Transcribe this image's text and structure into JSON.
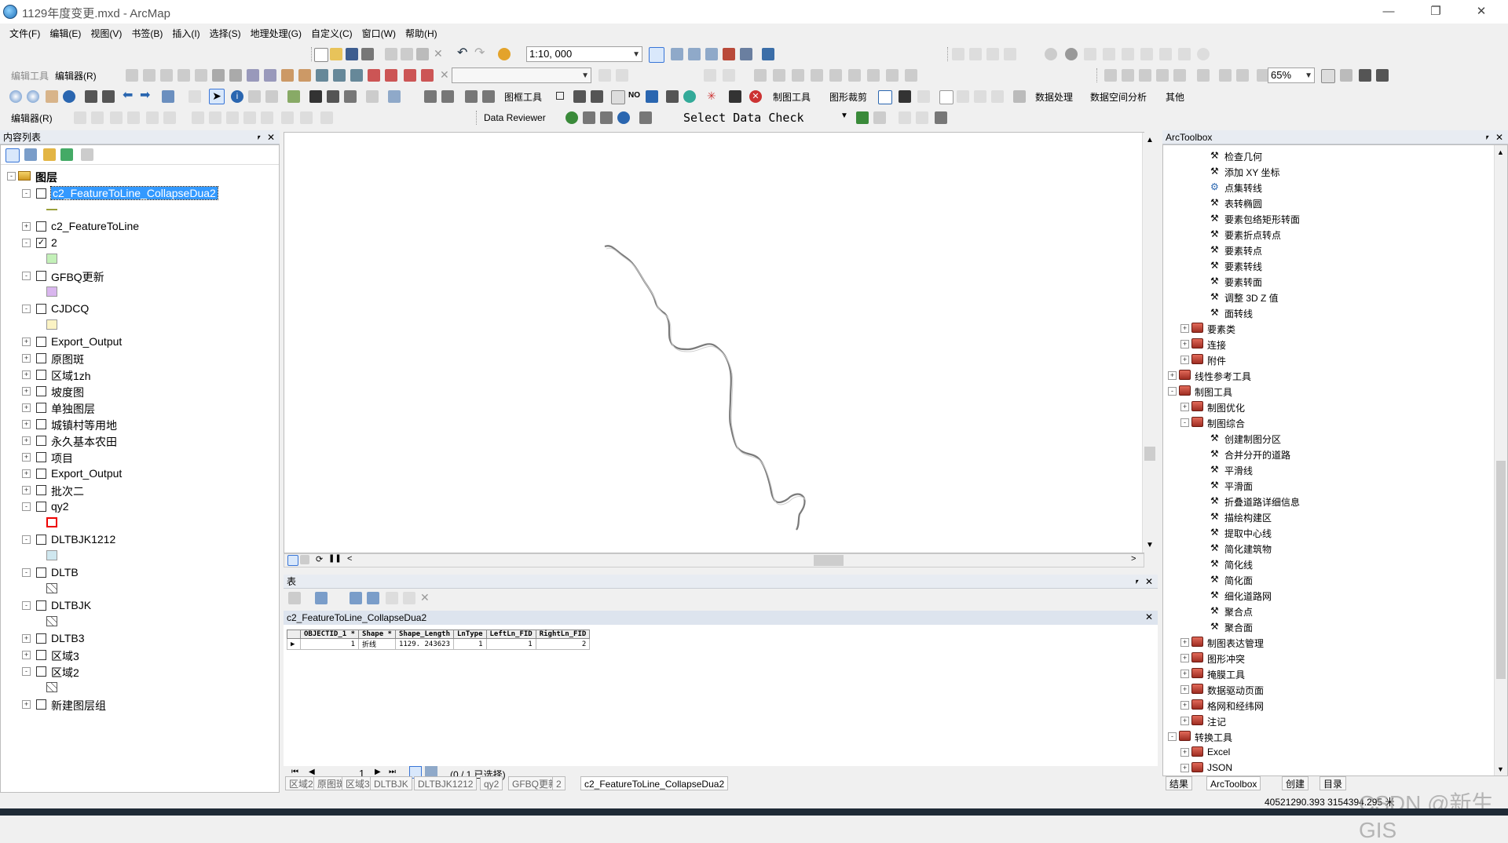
{
  "window": {
    "title": "1129年度变更.mxd - ArcMap"
  },
  "menu": [
    "文件(F)",
    "编辑(E)",
    "视图(V)",
    "书签(B)",
    "插入(I)",
    "选择(S)",
    "地理处理(G)",
    "自定义(C)",
    "窗口(W)",
    "帮助(H)"
  ],
  "toolbar": {
    "scale": "1:10, 000",
    "editor_tools_label": "编辑工具",
    "editor_menu": "编辑器(R)",
    "layout_tools": "图框工具",
    "cartography_tools": "制图工具",
    "graphic_clip": "图形裁剪",
    "data_processing": "数据处理",
    "spatial_analysis": "数据空间分析",
    "other": "其他",
    "no_label": "NO",
    "zoom_level": "65%",
    "editor2": "编辑器(R)",
    "data_reviewer": "Data Reviewer",
    "select_data_check": "Select Data Check"
  },
  "toc": {
    "title": "内容列表",
    "root": "图层",
    "layers": [
      {
        "name": "c2_FeatureToLine_CollapseDua2",
        "expanded": true,
        "checked": false,
        "selected": true,
        "symbol": "line-olive"
      },
      {
        "name": "c2_FeatureToLine",
        "expanded": false,
        "checked": false
      },
      {
        "name": "2",
        "expanded": true,
        "checked": true,
        "symbol": "fill-green"
      },
      {
        "name": "GFBQ更新",
        "expanded": true,
        "checked": false,
        "symbol": "fill-purple"
      },
      {
        "name": "CJDCQ",
        "expanded": true,
        "checked": false,
        "symbol": "fill-yellow"
      },
      {
        "name": "Export_Output",
        "expanded": false,
        "checked": false
      },
      {
        "name": "原图斑",
        "expanded": false,
        "checked": false
      },
      {
        "name": "区域1zh",
        "expanded": false,
        "checked": false
      },
      {
        "name": "坡度图",
        "expanded": false,
        "checked": false
      },
      {
        "name": "单独图层",
        "expanded": false,
        "checked": false
      },
      {
        "name": "城镇村等用地",
        "expanded": false,
        "checked": false
      },
      {
        "name": "永久基本农田",
        "expanded": false,
        "checked": false
      },
      {
        "name": "项目",
        "expanded": false,
        "checked": false
      },
      {
        "name": "Export_Output",
        "expanded": false,
        "checked": false
      },
      {
        "name": "批次二",
        "expanded": false,
        "checked": false
      },
      {
        "name": "qy2",
        "expanded": true,
        "checked": false,
        "symbol": "fill-red-outline"
      },
      {
        "name": "DLTBJK1212",
        "expanded": true,
        "checked": false,
        "symbol": "fill-lightblue"
      },
      {
        "name": "DLTB",
        "expanded": true,
        "checked": false,
        "symbol": "fill-hatch"
      },
      {
        "name": "DLTBJK",
        "expanded": true,
        "checked": false,
        "symbol": "fill-hatch"
      },
      {
        "name": "DLTB3",
        "expanded": false,
        "checked": false
      },
      {
        "name": "区域3",
        "expanded": false,
        "checked": false
      },
      {
        "name": "区域2",
        "expanded": true,
        "checked": false,
        "symbol": "fill-hatch"
      },
      {
        "name": "新建图层组",
        "expanded": false,
        "checked": false
      }
    ]
  },
  "table": {
    "title": "表",
    "layer": "c2_FeatureToLine_CollapseDua2",
    "columns": [
      "OBJECTID_1 *",
      "Shape *",
      "Shape_Length",
      "LnType",
      "LeftLn_FID",
      "RightLn_FID"
    ],
    "rows": [
      [
        "1",
        "折线",
        "1129. 243623",
        "1",
        "1",
        "2"
      ]
    ],
    "current_record": "1",
    "selection_status": "(0 / 1 已选择)",
    "tabs": [
      "区域2",
      "原图斑",
      "区域3",
      "DLTBJK",
      "DLTBJK1212",
      "qy2",
      "GFBQ更新",
      "2",
      "c2_FeatureToLine_CollapseDua2"
    ]
  },
  "toolbox": {
    "title": "ArcToolbox",
    "items": [
      {
        "label": "检查几何",
        "kind": "tool",
        "indent": 3
      },
      {
        "label": "添加 XY 坐标",
        "kind": "tool",
        "indent": 3
      },
      {
        "label": "点集转线",
        "kind": "script",
        "indent": 3
      },
      {
        "label": "表转椭圆",
        "kind": "tool",
        "indent": 3
      },
      {
        "label": "要素包络矩形转面",
        "kind": "tool",
        "indent": 3
      },
      {
        "label": "要素折点转点",
        "kind": "tool",
        "indent": 3
      },
      {
        "label": "要素转点",
        "kind": "tool",
        "indent": 3
      },
      {
        "label": "要素转线",
        "kind": "tool",
        "indent": 3
      },
      {
        "label": "要素转面",
        "kind": "tool",
        "indent": 3
      },
      {
        "label": "调整 3D Z 值",
        "kind": "tool",
        "indent": 3
      },
      {
        "label": "面转线",
        "kind": "tool",
        "indent": 3
      },
      {
        "label": "要素类",
        "kind": "toolset",
        "indent": 2,
        "exp": "+"
      },
      {
        "label": "连接",
        "kind": "toolset",
        "indent": 2,
        "exp": "+"
      },
      {
        "label": "附件",
        "kind": "toolset",
        "indent": 2,
        "exp": "+"
      },
      {
        "label": "线性参考工具",
        "kind": "toolbox",
        "indent": 1,
        "exp": "+"
      },
      {
        "label": "制图工具",
        "kind": "toolbox",
        "indent": 1,
        "exp": "-"
      },
      {
        "label": "制图优化",
        "kind": "toolset",
        "indent": 2,
        "exp": "+"
      },
      {
        "label": "制图综合",
        "kind": "toolset",
        "indent": 2,
        "exp": "-"
      },
      {
        "label": "创建制图分区",
        "kind": "tool",
        "indent": 3
      },
      {
        "label": "合并分开的道路",
        "kind": "tool",
        "indent": 3
      },
      {
        "label": "平滑线",
        "kind": "tool",
        "indent": 3
      },
      {
        "label": "平滑面",
        "kind": "tool",
        "indent": 3
      },
      {
        "label": "折叠道路详细信息",
        "kind": "tool",
        "indent": 3
      },
      {
        "label": "描绘构建区",
        "kind": "tool",
        "indent": 3
      },
      {
        "label": "提取中心线",
        "kind": "tool",
        "indent": 3
      },
      {
        "label": "简化建筑物",
        "kind": "tool",
        "indent": 3
      },
      {
        "label": "简化线",
        "kind": "tool",
        "indent": 3
      },
      {
        "label": "简化面",
        "kind": "tool",
        "indent": 3
      },
      {
        "label": "细化道路网",
        "kind": "tool",
        "indent": 3
      },
      {
        "label": "聚合点",
        "kind": "tool",
        "indent": 3
      },
      {
        "label": "聚合面",
        "kind": "tool",
        "indent": 3
      },
      {
        "label": "制图表达管理",
        "kind": "toolset",
        "indent": 2,
        "exp": "+"
      },
      {
        "label": "图形冲突",
        "kind": "toolset",
        "indent": 2,
        "exp": "+"
      },
      {
        "label": "掩膜工具",
        "kind": "toolset",
        "indent": 2,
        "exp": "+"
      },
      {
        "label": "数据驱动页面",
        "kind": "toolset",
        "indent": 2,
        "exp": "+"
      },
      {
        "label": "格网和经纬网",
        "kind": "toolset",
        "indent": 2,
        "exp": "+"
      },
      {
        "label": "注记",
        "kind": "toolset",
        "indent": 2,
        "exp": "+"
      },
      {
        "label": "转换工具",
        "kind": "toolbox",
        "indent": 1,
        "exp": "-"
      },
      {
        "label": "Excel",
        "kind": "toolset",
        "indent": 2,
        "exp": "+"
      },
      {
        "label": "JSON",
        "kind": "toolset",
        "indent": 2,
        "exp": "+"
      }
    ],
    "tabs": [
      "结果",
      "ArcToolbox",
      "创建",
      "目录"
    ]
  },
  "status": {
    "coords": "40521290.393  3154394.295 米",
    "watermark": "CSDN @新生GIS"
  },
  "colors": {
    "selection": "#3399ff",
    "line": "#8a8a8a"
  }
}
